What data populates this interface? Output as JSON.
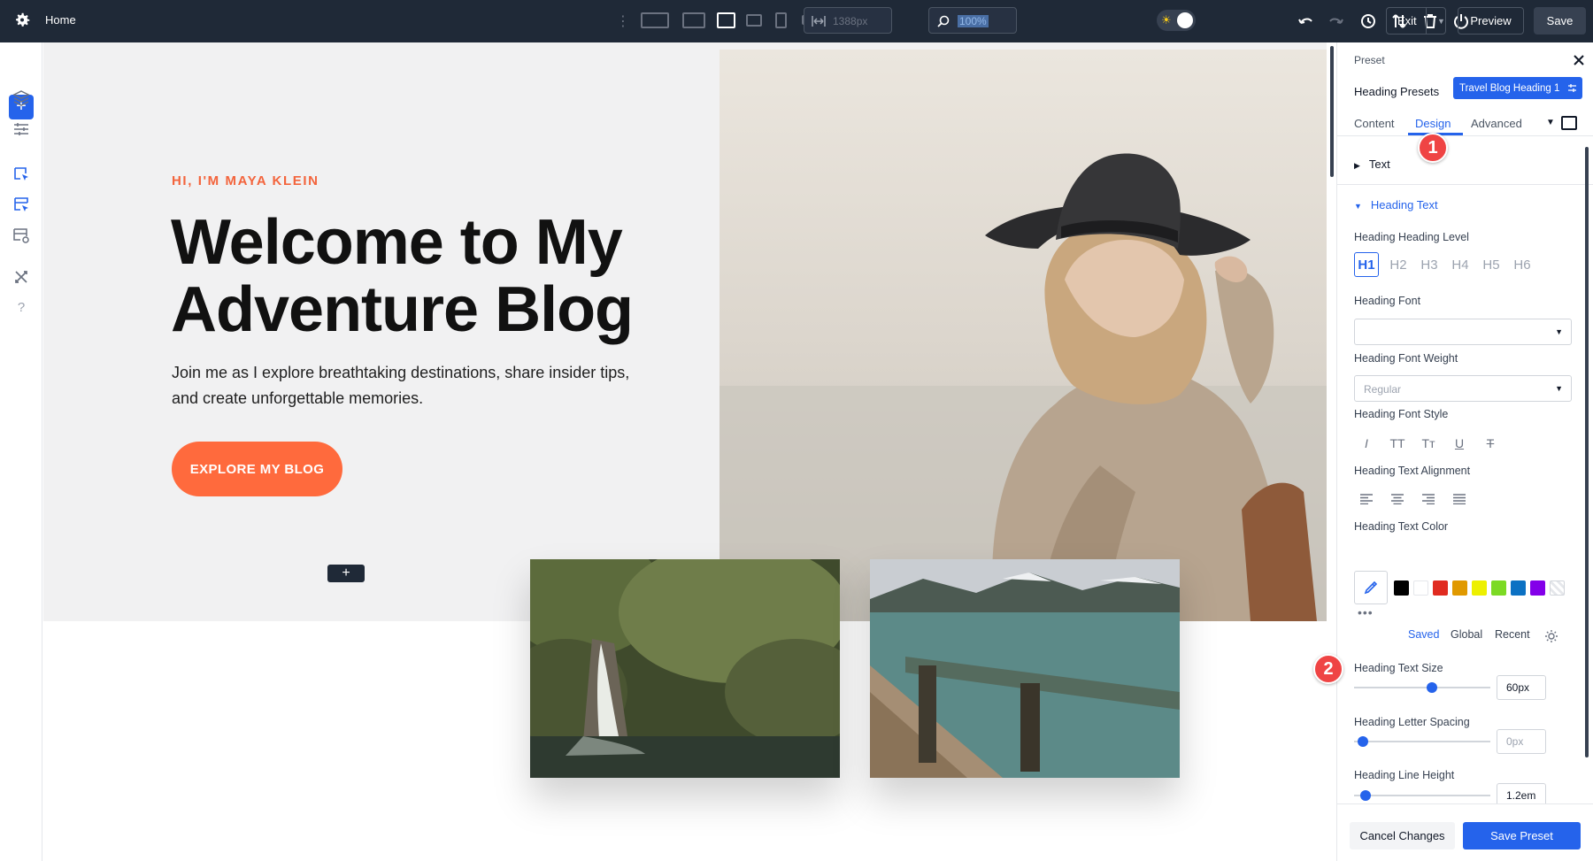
{
  "topbar": {
    "page": "Home",
    "width_value": "1388px",
    "zoom_value": "100%",
    "exit_label": "Exit",
    "preview_label": "Preview",
    "save_label": "Save"
  },
  "hero": {
    "eyebrow": "HI, I'M MAYA KLEIN",
    "title": "Welcome to My Adventure Blog",
    "subtitle": "Join me as I explore breathtaking destinations, share insider tips, and create unforgettable memories.",
    "cta": "EXPLORE MY BLOG",
    "add_row": "+"
  },
  "panel": {
    "preset_label": "Preset",
    "presets_title": "Heading Presets",
    "preset_badge": "Travel Blog Heading 1",
    "tabs": [
      {
        "label": "Content"
      },
      {
        "label": "Design"
      },
      {
        "label": "Advanced"
      }
    ],
    "markers": [
      "1",
      "2"
    ],
    "sections": {
      "text": "Text",
      "heading_text": "Heading Text"
    },
    "labels": {
      "heading_level": "Heading Heading Level",
      "font": "Heading Font",
      "font_weight": "Heading Font Weight",
      "font_style": "Heading Font Style",
      "text_alignment": "Heading Text Alignment",
      "text_color": "Heading Text Color",
      "text_size": "Heading Text Size",
      "letter_spacing": "Heading Letter Spacing",
      "line_height": "Heading Line Height"
    },
    "heading_levels": [
      "H1",
      "H2",
      "H3",
      "H4",
      "H5",
      "H6"
    ],
    "font_value": "",
    "font_weight_value": "Regular",
    "style_icons": [
      "I",
      "TT",
      "Tт",
      "U",
      "T"
    ],
    "palette_tabs": [
      "Saved",
      "Global",
      "Recent"
    ],
    "swatch_colors": [
      "#000000",
      "#ffffff",
      "#e02b20",
      "#e09900",
      "#edf000",
      "#7cda24",
      "#0c71c3",
      "#8300e9"
    ],
    "text_size_value": "60px",
    "letter_spacing_value": "0px",
    "line_height_value": "1.2em",
    "sliders": {
      "text_size": 0.58,
      "letter_spacing": 0.03,
      "line_height": 0.05
    },
    "cancel_label": "Cancel Changes",
    "save_preset_label": "Save Preset"
  },
  "colors": {
    "accent": "#2563eb",
    "brand_orange": "#ff6a3d",
    "topbar": "#1f2937",
    "marker": "#ef4444"
  }
}
